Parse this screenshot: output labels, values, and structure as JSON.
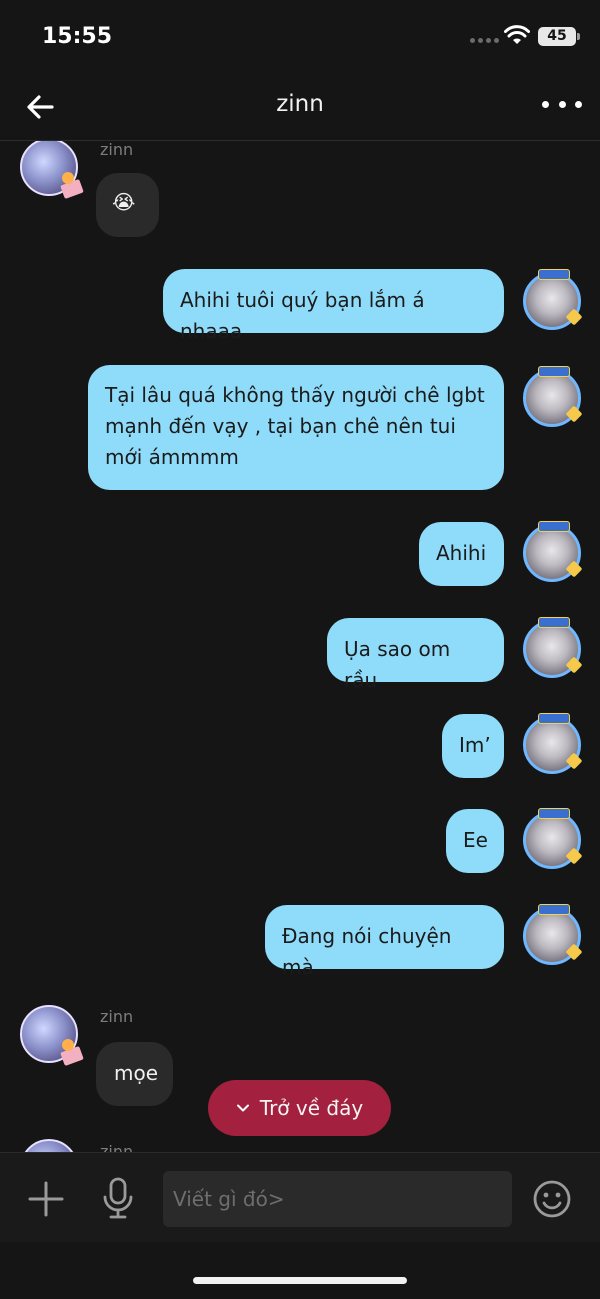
{
  "status_bar": {
    "time": "15:55",
    "battery": "45"
  },
  "header": {
    "title": "zinn"
  },
  "messages": [
    {
      "from": "zinn",
      "sender_name": "zinn",
      "text": "😭"
    },
    {
      "from": "me",
      "text": "Ahihi tuôi quý bạn lắm á nhaaa"
    },
    {
      "from": "me",
      "text": "Tại lâu quá không thấy người chê lgbt mạnh đến vạy , tại bạn chê nên tui mới ámmmm"
    },
    {
      "from": "me",
      "text": "Ahihi"
    },
    {
      "from": "me",
      "text": "Ụa sao om rầu"
    },
    {
      "from": "me",
      "text": "Im’"
    },
    {
      "from": "me",
      "text": "Ee"
    },
    {
      "from": "me",
      "text": "Đang nói chuyện mà"
    },
    {
      "from": "zinn",
      "sender_name": "zinn",
      "text": "mọe"
    },
    {
      "from": "zinn",
      "sender_name": "zinn",
      "text": ""
    }
  ],
  "jump_button": {
    "label": "Trở về đáy"
  },
  "composer": {
    "placeholder": "Viết gì đó>"
  }
}
